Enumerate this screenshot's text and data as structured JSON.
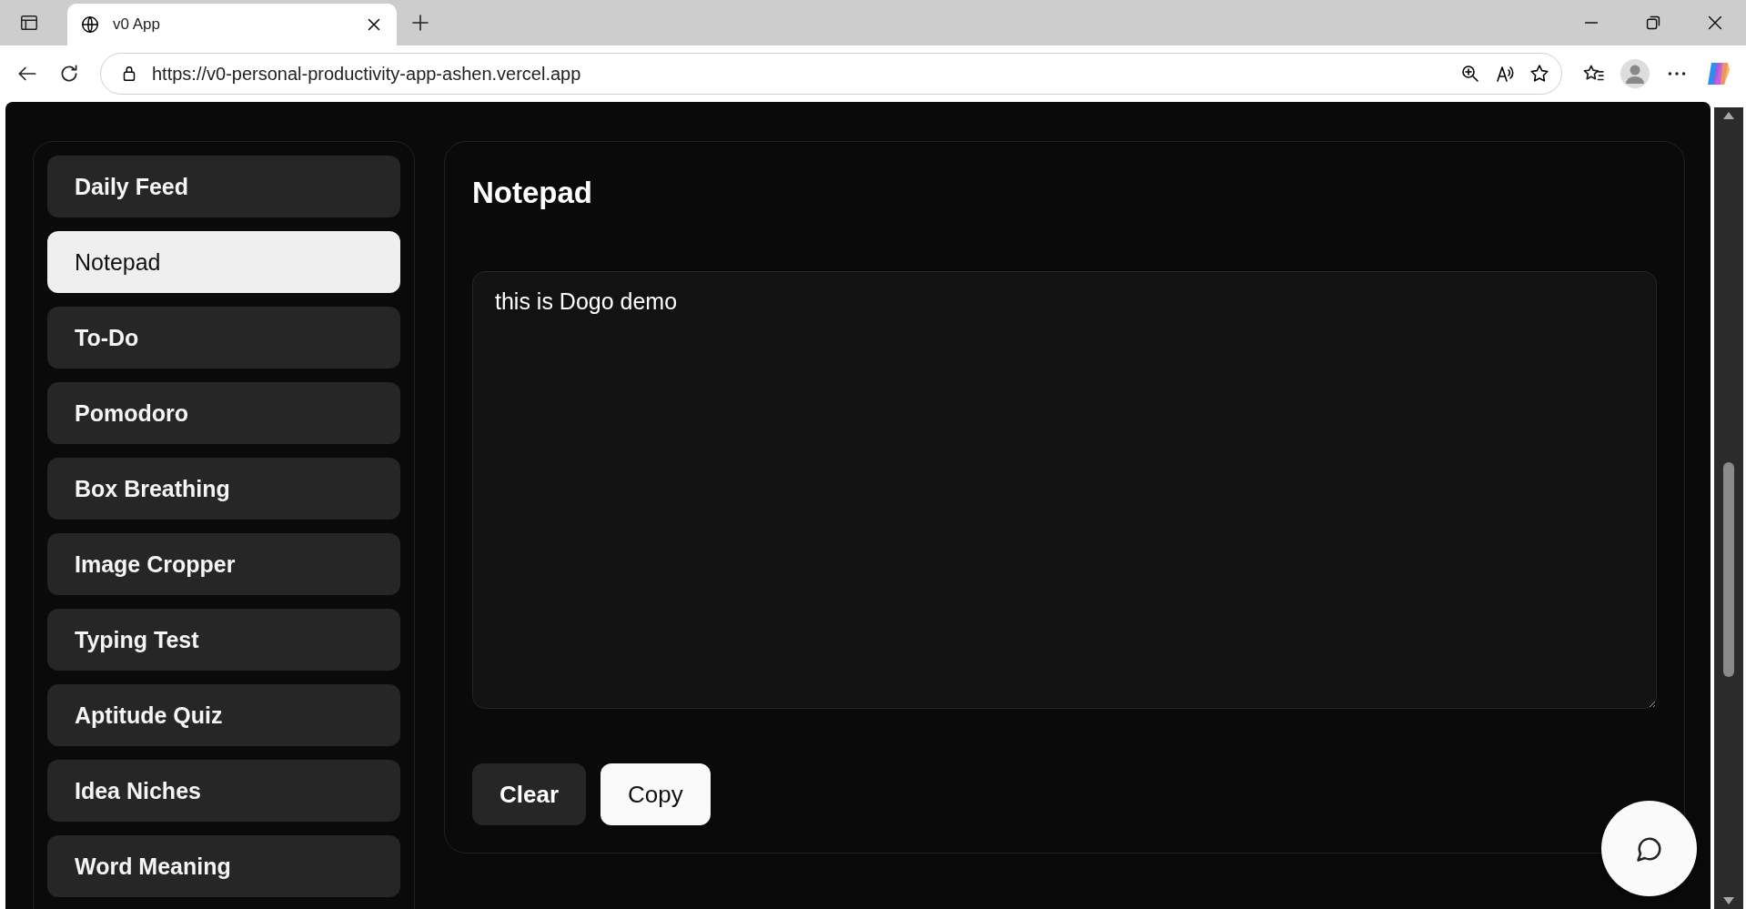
{
  "browser": {
    "tab_title": "v0 App",
    "url": "https://v0-personal-productivity-app-ashen.vercel.app"
  },
  "sidebar": {
    "items": [
      {
        "label": "Daily Feed",
        "selected": false
      },
      {
        "label": "Notepad",
        "selected": true
      },
      {
        "label": "To-Do",
        "selected": false
      },
      {
        "label": "Pomodoro",
        "selected": false
      },
      {
        "label": "Box Breathing",
        "selected": false
      },
      {
        "label": "Image Cropper",
        "selected": false
      },
      {
        "label": "Typing Test",
        "selected": false
      },
      {
        "label": "Aptitude Quiz",
        "selected": false
      },
      {
        "label": "Idea Niches",
        "selected": false
      },
      {
        "label": "Word Meaning",
        "selected": false
      }
    ]
  },
  "notepad": {
    "title": "Notepad",
    "text": "this is Dogo demo",
    "buttons": [
      {
        "label": "Clear",
        "kind": "secondary"
      },
      {
        "label": "Copy",
        "kind": "primary"
      }
    ]
  }
}
